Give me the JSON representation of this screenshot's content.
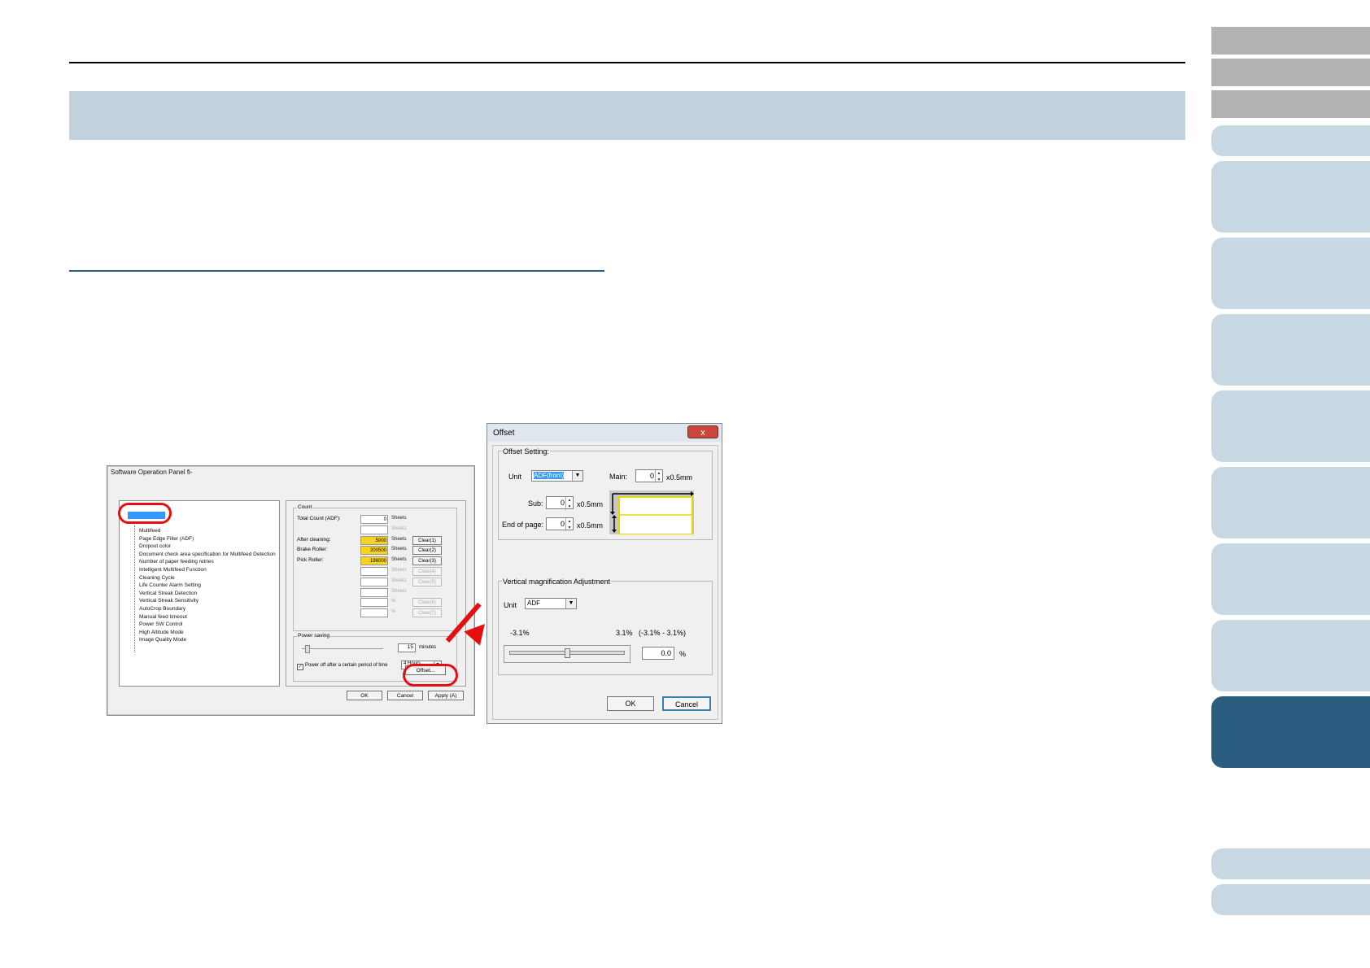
{
  "sop_dialog": {
    "title": "Software Operation Panel fi-",
    "tree_items": [
      "Multifeed",
      "Page Edge Filler (ADF)",
      "Dropout color",
      "Document check area specification for Multifeed Detection",
      "Number of paper feeding retries",
      "Intelligent Multifeed Function",
      "Cleaning Cycle",
      "Life Counter Alarm Setting",
      "Vertical Streak Detection",
      "Vertical Streak Sensitivity",
      "AutoCrop Boundary",
      "Manual feed timeout",
      "Power SW Control",
      "High Altitude Mode",
      "Image Quality Mode"
    ],
    "count_group": "Count",
    "rows": [
      {
        "label": "Total Count (ADF):",
        "value": "0",
        "unit": "Sheets",
        "btn": ""
      },
      {
        "label": "",
        "value": "",
        "unit": "Sheets",
        "btn": ""
      },
      {
        "label": "After cleaning:",
        "value": "5000",
        "unit": "Sheets",
        "btn": "Clear(1)"
      },
      {
        "label": "Brake Roller:",
        "value": "200500",
        "unit": "Sheets",
        "btn": "Clear(2)"
      },
      {
        "label": "Pick Roller:",
        "value": "196000",
        "unit": "Sheets",
        "btn": "Clear(3)"
      },
      {
        "label": "",
        "value": "",
        "unit": "Sheets",
        "btn": "Clear(4)"
      },
      {
        "label": "",
        "value": "",
        "unit": "Sheets",
        "btn": "Clear(5)"
      },
      {
        "label": "",
        "value": "",
        "unit": "Sheets",
        "btn": ""
      },
      {
        "label": "",
        "value": "",
        "unit": "%",
        "btn": "Clear(6)"
      },
      {
        "label": "",
        "value": "",
        "unit": "%",
        "btn": "Clear(7)"
      }
    ],
    "power_group": "Power saving",
    "power_value": "15",
    "power_unit": "minutes",
    "power_off_label": "Power off after a certain period of time",
    "power_off_value": "4 Hours",
    "offset_button": "Offset...",
    "ok": "OK",
    "cancel": "Cancel",
    "apply": "Apply (A)"
  },
  "offset_dialog": {
    "title": "Offset",
    "close": "x",
    "offset_group": "Offset Setting:",
    "unit_label": "Unit",
    "unit_value": "ADF(front)",
    "main_label": "Main:",
    "main_value": "0",
    "main_unit": "x0.5mm",
    "sub_label": "Sub:",
    "sub_value": "0",
    "sub_unit": "x0.5mm",
    "end_label": "End of page:",
    "end_value": "0",
    "end_unit": "x0.5mm",
    "vm_group": "Vertical magnification Adjustment",
    "vm_unit_label": "Unit",
    "vm_unit_value": "ADF",
    "min_label": "-3.1%",
    "max_label": "3.1%",
    "range_label": "(-3.1% - 3.1%)",
    "vm_value": "0.0",
    "vm_pct": "%",
    "ok": "OK",
    "cancel": "Cancel"
  },
  "colors": {
    "banner": "#c1d2dc",
    "tab": "#c8d8e2",
    "tab_active": "#2a5d7f",
    "highlight": "#e41010",
    "counter": "#f8d21c"
  }
}
